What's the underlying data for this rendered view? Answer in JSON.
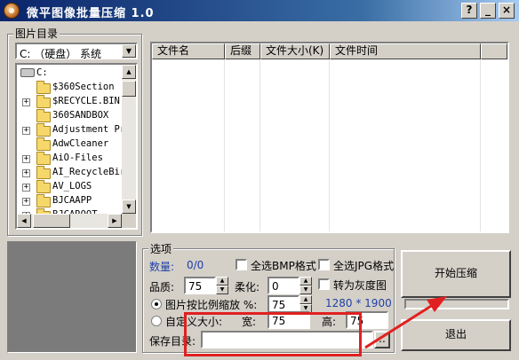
{
  "window": {
    "title": "微平图像批量压缩 1.0",
    "help": "?",
    "minimize": "_",
    "close": "×"
  },
  "folder_panel": {
    "label": "图片目录",
    "drive": "C: （硬盘） 系统",
    "tree": [
      {
        "text": "C:",
        "kind": "drive"
      },
      {
        "text": "$360Section",
        "kind": "folder",
        "expander": false
      },
      {
        "text": "$RECYCLE.BIN",
        "kind": "folder",
        "expander": true
      },
      {
        "text": "360SANDBOX",
        "kind": "folder",
        "expander": false
      },
      {
        "text": "Adjustment Pr",
        "kind": "folder",
        "expander": true
      },
      {
        "text": "AdwCleaner",
        "kind": "folder",
        "expander": false
      },
      {
        "text": "AiO-Files",
        "kind": "folder",
        "expander": true
      },
      {
        "text": "AI_RecycleBir",
        "kind": "folder",
        "expander": true
      },
      {
        "text": "AV_LOGS",
        "kind": "folder",
        "expander": true
      },
      {
        "text": "BJCAAPP",
        "kind": "folder",
        "expander": true
      },
      {
        "text": "BJCAROOT",
        "kind": "folder",
        "expander": true
      }
    ]
  },
  "file_list": {
    "columns": [
      "文件名",
      "后缀",
      "文件大小(K)",
      "文件时间"
    ]
  },
  "options": {
    "label": "选项",
    "count_label": "数量:",
    "count_value": "0/0",
    "select_bmp": "全选BMP格式",
    "select_jpg": "全选JPG格式",
    "quality_label": "品质:",
    "quality_value": "75",
    "soften_label": "柔化:",
    "soften_value": "0",
    "grayscale": "转为灰度图",
    "scale_by_ratio": "图片按比例缩放 %:",
    "scale_value": "75",
    "resolution": "1280 * 1900",
    "custom_size": "自定义大小:",
    "width_label": "宽:",
    "width_value": "75",
    "height_label": "高:",
    "height_value": "75",
    "save_dir_label": "保存目录:",
    "save_dir_value": "",
    "browse": ".."
  },
  "actions": {
    "start": "开始压缩",
    "exit": "退出"
  },
  "colors": {
    "annotation": "#e02020",
    "accent_text": "#1f3fa8"
  }
}
